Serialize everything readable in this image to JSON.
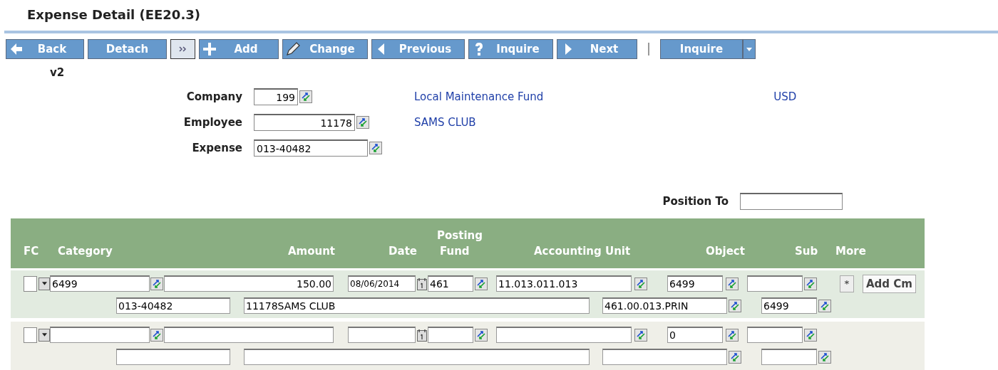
{
  "page_title": "Expense Detail (EE20.3)",
  "toolbar": [
    {
      "kind": "button",
      "label": "Back"
    },
    {
      "kind": "button",
      "label": "Detach"
    },
    {
      "kind": "expand"
    },
    {
      "kind": "button",
      "label": "Add"
    },
    {
      "kind": "button",
      "label": "Change"
    },
    {
      "kind": "button",
      "label": "Previous"
    },
    {
      "kind": "button",
      "label": "Inquire"
    },
    {
      "kind": "button",
      "label": "Next"
    },
    {
      "kind": "separator"
    },
    {
      "kind": "split",
      "label": "Inquire"
    }
  ],
  "version": "v2",
  "fields": [
    {
      "label": "Company",
      "value": "199",
      "kind": "number",
      "description": "Local Maintenance Fund",
      "currency": "USD"
    },
    {
      "label": "Employee",
      "value": "11178",
      "kind": "number",
      "description": "SAMS CLUB"
    },
    {
      "label": "Expense",
      "value": "013-40482",
      "kind": "text"
    }
  ],
  "position_to": {
    "label": "Position To"
  },
  "table": {
    "group_header": "Posting",
    "columns": [
      "FC",
      "Category",
      "Amount",
      "Date",
      "Fund",
      "Accounting Unit",
      "Object",
      "Sub",
      "More"
    ],
    "rows": [
      {
        "fc_checked": false,
        "category": "6499",
        "amount": "150.00",
        "date": "08/06/2014",
        "fund": "461",
        "accounting_unit": "11.013.011.013",
        "object": "6499",
        "more": "*",
        "comment_button": "Add Cm",
        "second_line": [
          "013-40482",
          "11178SAMS CLUB",
          "461.00.013.PRIN",
          "6499"
        ]
      },
      {
        "fc_checked": false,
        "object": "0"
      }
    ]
  }
}
